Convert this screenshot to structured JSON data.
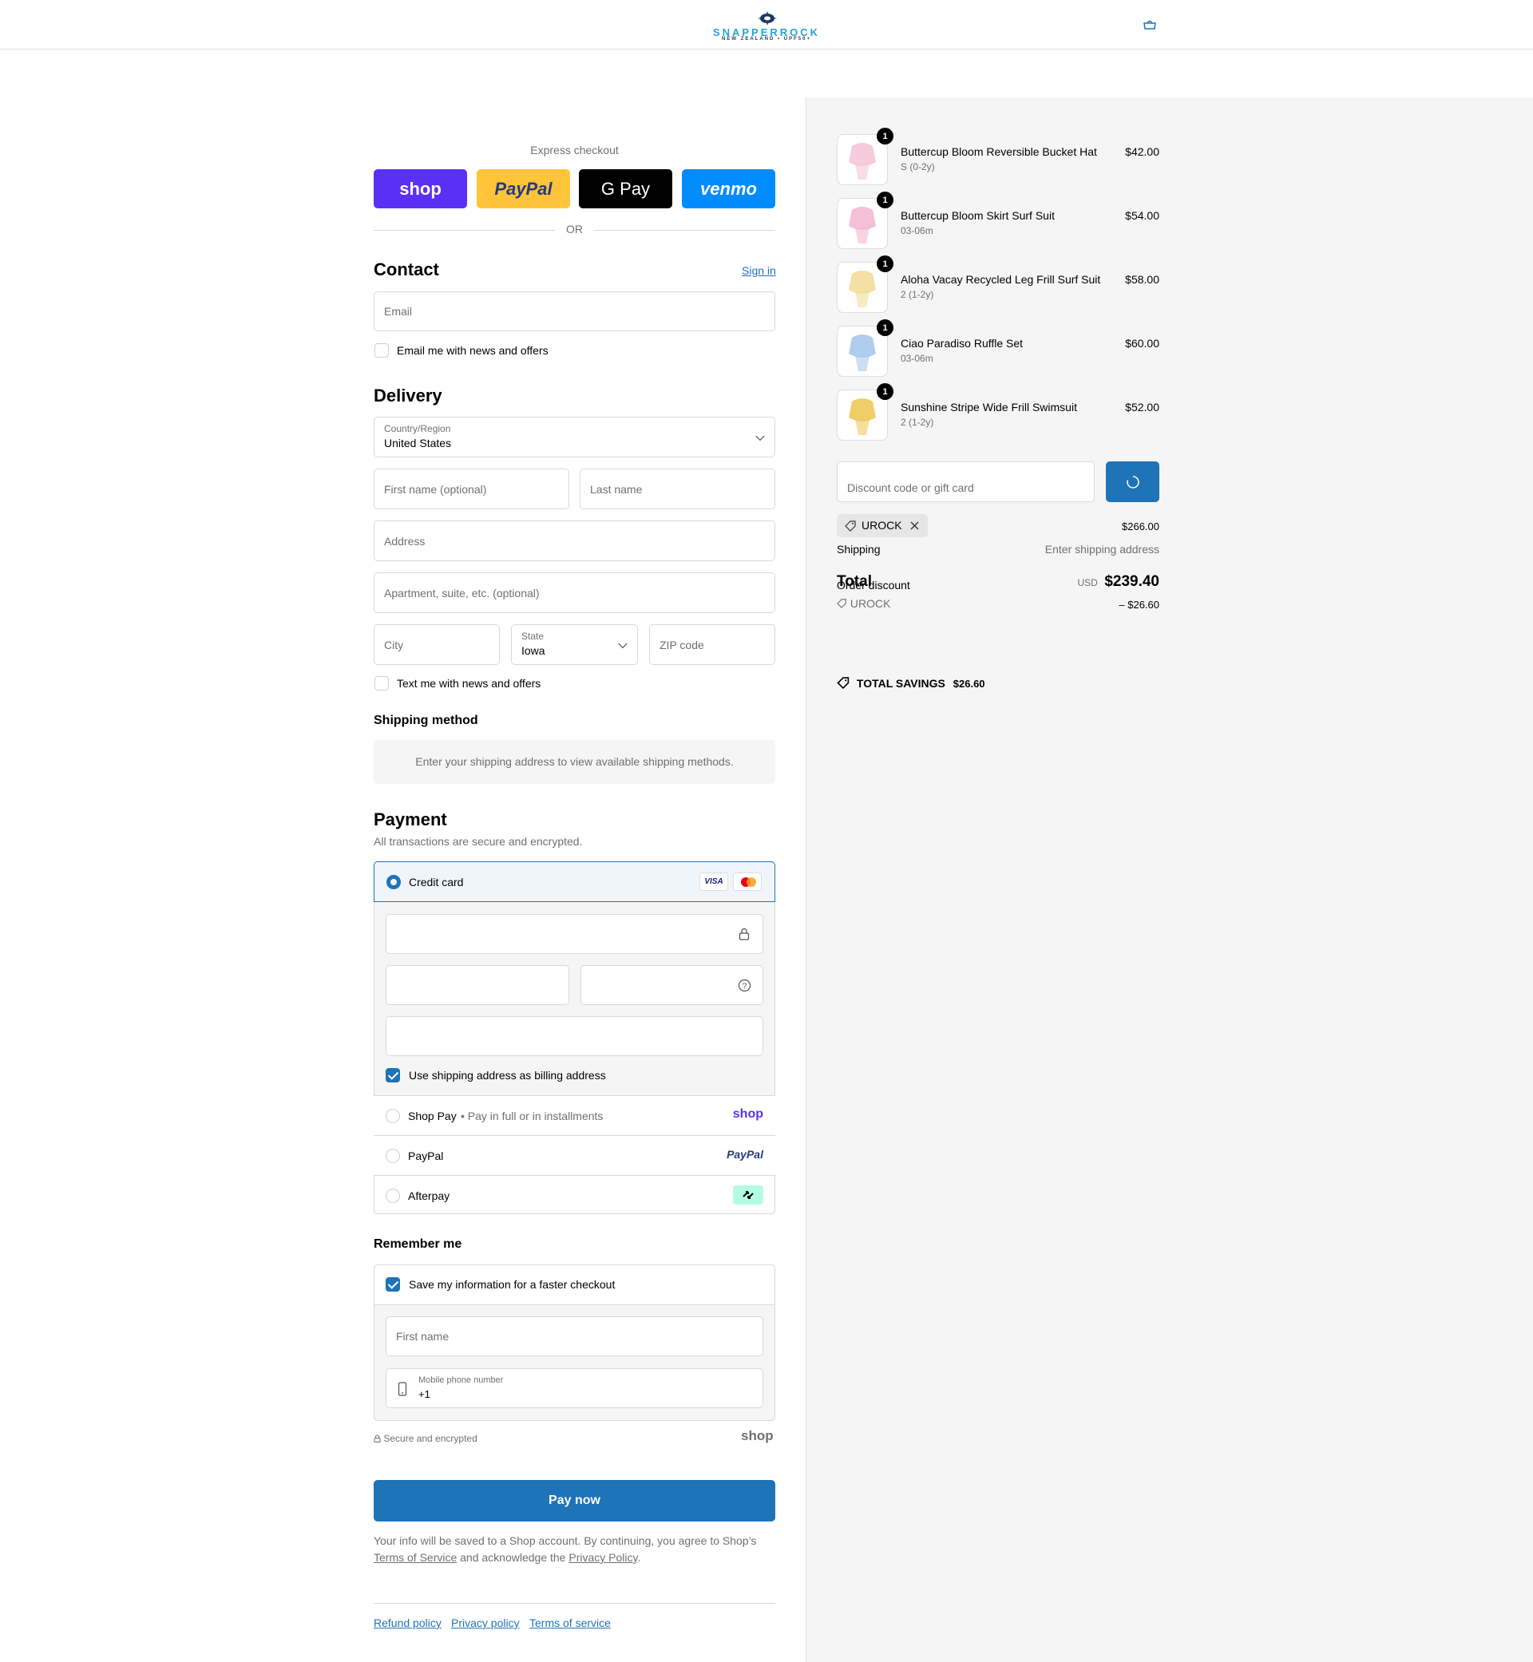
{
  "header": {
    "brand": "SNAPPERROCK",
    "tagline": "NEW ZEALAND • UPF50+",
    "cart_icon": "bag-icon"
  },
  "express": {
    "title": "Express checkout",
    "buttons": [
      {
        "label": "shop",
        "color": "#5a31f4"
      },
      {
        "label": "PayPal",
        "color": "#ffc439"
      },
      {
        "label": "G Pay",
        "color": "#000000"
      },
      {
        "label": "venmo",
        "color": "#008cff"
      }
    ],
    "or": "OR"
  },
  "contact": {
    "title": "Contact",
    "sign_in": "Sign in",
    "email_placeholder": "Email",
    "news_label": "Email me with news and offers"
  },
  "delivery": {
    "title": "Delivery",
    "country_label": "Country/Region",
    "country_value": "United States",
    "first_name": "First name (optional)",
    "last_name": "Last name",
    "address": "Address",
    "apartment": "Apartment, suite, etc. (optional)",
    "city": "City",
    "state_label": "State",
    "state_value": "Iowa",
    "zip": "ZIP code",
    "text_news": "Text me with news and offers"
  },
  "shipping_method": {
    "title": "Shipping method",
    "notice": "Enter your shipping address to view available shipping methods."
  },
  "payment": {
    "title": "Payment",
    "subtitle": "All transactions are secure and encrypted.",
    "credit_card": "Credit card",
    "card_brands": [
      "VISA",
      "mastercard"
    ],
    "billing_same": "Use shipping address as billing address",
    "shop_pay": "Shop Pay",
    "shop_pay_note": "Pay in full or in installments",
    "shop_pay_logo": "shop",
    "paypal": "PayPal",
    "paypal_logo": "PayPal",
    "afterpay": "Afterpay"
  },
  "remember": {
    "title": "Remember me",
    "save_label": "Save my information for a faster checkout",
    "first_name": "First name",
    "phone_label": "Mobile phone number",
    "phone_value": "+1",
    "secure": "Secure and encrypted",
    "shop_logo": "shop"
  },
  "pay_now": "Pay now",
  "legal": {
    "text1": "Your info will be saved to a Shop account. By continuing, you agree to Shop’s",
    "tos": "Terms of Service",
    "text2": "and acknowledge the",
    "privacy": "Privacy Policy",
    "period": "."
  },
  "footer_links": [
    "Refund policy",
    "Privacy policy",
    "Terms of service"
  ],
  "cart": {
    "items": [
      {
        "name": "Buttercup Bloom Reversible Bucket Hat",
        "variant": "S (0-2y)",
        "price": "$42.00",
        "qty": "1",
        "color": "#f3c6d8"
      },
      {
        "name": "Buttercup Bloom Skirt Surf Suit",
        "variant": "03-06m",
        "price": "$54.00",
        "qty": "1",
        "color": "#f4b8d0"
      },
      {
        "name": "Aloha Vacay Recycled Leg Frill Surf Suit",
        "variant": "2 (1-2y)",
        "price": "$58.00",
        "qty": "1",
        "color": "#f2dd9a"
      },
      {
        "name": "Ciao Paradiso Ruffle Set",
        "variant": "03-06m",
        "price": "$60.00",
        "qty": "1",
        "color": "#a9c8ec"
      },
      {
        "name": "Sunshine Stripe Wide Frill Swimsuit",
        "variant": "2 (1-2y)",
        "price": "$52.00",
        "qty": "1",
        "color": "#f0c85a"
      }
    ],
    "discount_placeholder": "Discount code or gift card",
    "code": "UROCK",
    "subtotal": "$266.00",
    "shipping_label": "Shipping",
    "shipping_value": "Enter shipping address",
    "order_discount": "Order discount",
    "total_label": "Total",
    "currency": "USD",
    "total": "$239.40",
    "discount_code": "UROCK",
    "discount_amount": "– $26.60",
    "savings_label": "TOTAL SAVINGS",
    "savings_amount": "$26.60"
  },
  "colors": {
    "accent": "#1f73b7"
  }
}
